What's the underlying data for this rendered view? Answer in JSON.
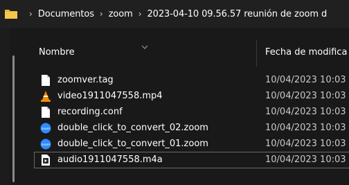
{
  "breadcrumb": {
    "items": [
      "Documentos",
      "zoom",
      "2023-04-10 09.56.57 reunión de zoom d"
    ]
  },
  "columns": {
    "name": "Nombre",
    "date": "Fecha de modifica"
  },
  "files": [
    {
      "name": "zoomver.tag",
      "date": "10/04/2023 10:03",
      "icon": "document-icon"
    },
    {
      "name": "video1911047558.mp4",
      "date": "10/04/2023 10:03",
      "icon": "vlc-cone-icon"
    },
    {
      "name": "recording.conf",
      "date": "10/04/2023 10:03",
      "icon": "document-icon"
    },
    {
      "name": "double_click_to_convert_02.zoom",
      "date": "10/04/2023 10:03",
      "icon": "zoom-icon"
    },
    {
      "name": "double_click_to_convert_01.zoom",
      "date": "10/04/2023 10:03",
      "icon": "zoom-icon"
    },
    {
      "name": "audio1911047558.m4a",
      "date": "10/04/2023 10:03",
      "icon": "audio-file-icon"
    }
  ],
  "colors": {
    "background": "#191919",
    "folder": "#f0c040",
    "zoom": "#2d8cff",
    "vlc": "#f08a00"
  }
}
